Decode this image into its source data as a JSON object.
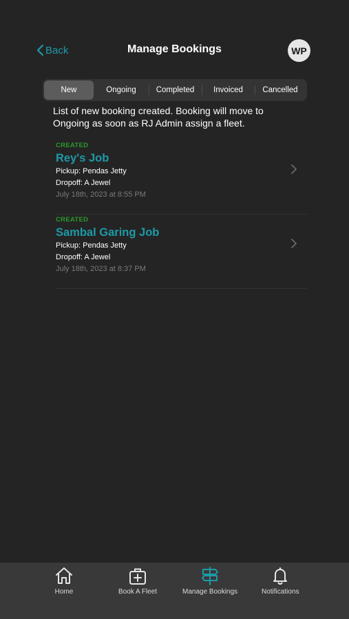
{
  "header": {
    "back_label": "Back",
    "title": "Manage Bookings",
    "avatar_initials": "WP"
  },
  "segments": [
    {
      "label": "New",
      "active": true
    },
    {
      "label": "Ongoing",
      "active": false
    },
    {
      "label": "Completed",
      "active": false
    },
    {
      "label": "Invoiced",
      "active": false
    },
    {
      "label": "Cancelled",
      "active": false
    }
  ],
  "description": "List of new booking created. Booking will move to Ongoing as soon as RJ Admin assign a fleet.",
  "bookings": [
    {
      "status": "CREATED",
      "title": "Rey's Job",
      "pickup": "Pickup: Pendas Jetty",
      "dropoff": "Dropoff: A Jewel",
      "datetime": "July 18th, 2023 at 8:55 PM"
    },
    {
      "status": "CREATED",
      "title": "Sambal Garing Job",
      "pickup": "Pickup: Pendas Jetty",
      "dropoff": "Dropoff: A Jewel",
      "datetime": "July 18th, 2023 at 8:37 PM"
    }
  ],
  "tabbar": {
    "items": [
      {
        "label": "Home",
        "icon": "home-icon",
        "active": false
      },
      {
        "label": "Book A Fleet",
        "icon": "medical-bag-plus-icon",
        "active": false
      },
      {
        "label": "Manage Bookings",
        "icon": "signpost-icon",
        "active": true
      },
      {
        "label": "Notifications",
        "icon": "bell-icon",
        "active": false
      }
    ]
  },
  "colors": {
    "background": "#242424",
    "accent": "#1d9aa8",
    "status_created": "#2c9a2c",
    "tabbar": "#393939"
  }
}
